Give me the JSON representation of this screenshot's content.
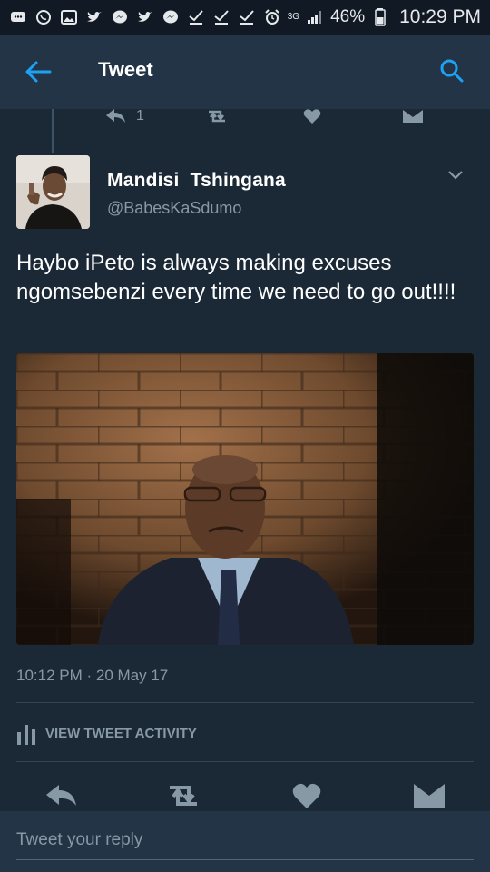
{
  "status_bar": {
    "network": "3G",
    "battery_percent": "46%",
    "time": "10:29 PM",
    "left_icons": [
      "message-icon",
      "whatsapp-icon",
      "gallery-icon",
      "twitter-icon",
      "messenger-icon",
      "twitter-icon",
      "messenger-icon",
      "check-icon",
      "check-icon",
      "check-icon"
    ]
  },
  "app_bar": {
    "title": "Tweet"
  },
  "previous_tweet_actions": {
    "reply_count": "1"
  },
  "tweet": {
    "display_name": "Mandisi  Tshingana",
    "handle": "@BabesKaSdumo",
    "text": "Haybo iPeto is always making excuses ngomsebenzi every time we need to go out!!!!",
    "timestamp": "10:12 PM · 20 May 17",
    "activity_label": "VIEW TWEET ACTIVITY"
  },
  "reply": {
    "placeholder": "Tweet your reply"
  },
  "colors": {
    "accent": "#1da1f2",
    "background": "#1b2836",
    "appbar": "#243447",
    "muted": "#8899a6"
  }
}
